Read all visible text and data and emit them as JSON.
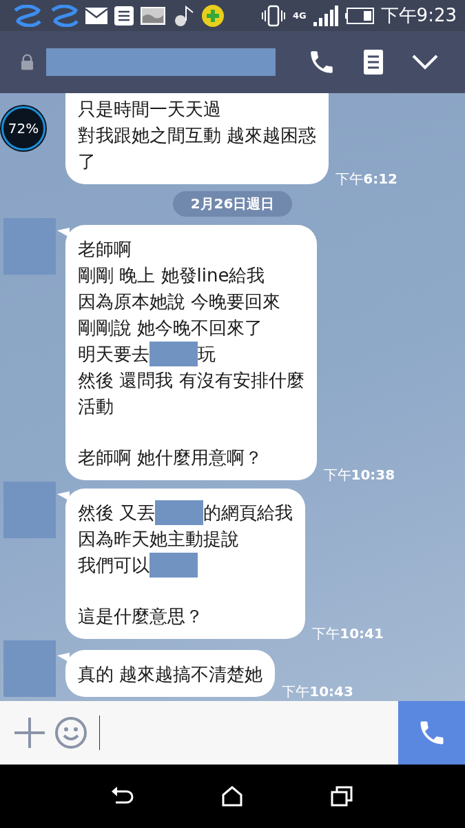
{
  "status_bar": {
    "network": "4G",
    "time": "下午9:23"
  },
  "battery_widget": {
    "text": "72%"
  },
  "chat": [
    {
      "kind": "message",
      "avatar": false,
      "cut_top": true,
      "paragraphs": [
        [
          [
            {
              "kind": "text",
              "text": "只是時間一天天過"
            }
          ],
          [
            {
              "kind": "text",
              "text": "對我跟她之間互動 越來越困惑"
            }
          ],
          [
            {
              "kind": "text",
              "text": "了"
            }
          ]
        ]
      ],
      "time": "下午**6:12**"
    },
    {
      "kind": "date",
      "text": "2月26日週日"
    },
    {
      "kind": "message",
      "avatar": true,
      "cut_top": false,
      "paragraphs": [
        [
          [
            {
              "kind": "text",
              "text": "老師啊"
            }
          ],
          [
            {
              "kind": "text",
              "text": "剛剛 晚上 她發line給我"
            }
          ],
          [
            {
              "kind": "text",
              "text": "因為原本她說 今晚要回來"
            }
          ],
          [
            {
              "kind": "text",
              "text": "剛剛說 她今晚不回來了"
            }
          ],
          [
            {
              "kind": "text",
              "text": "明天要去"
            },
            {
              "kind": "redacted"
            },
            {
              "kind": "text",
              "text": "玩"
            }
          ],
          [
            {
              "kind": "text",
              "text": "然後 還問我 有沒有安排什麼"
            }
          ],
          [
            {
              "kind": "text",
              "text": "活動"
            }
          ]
        ],
        [
          [
            {
              "kind": "text",
              "text": "老師啊 她什麼用意啊？"
            }
          ]
        ]
      ],
      "time": "下午**10:38**"
    },
    {
      "kind": "message",
      "avatar": true,
      "cut_top": false,
      "paragraphs": [
        [
          [
            {
              "kind": "text",
              "text": "然後 又丟"
            },
            {
              "kind": "redacted"
            },
            {
              "kind": "text",
              "text": "的網頁給我"
            }
          ],
          [
            {
              "kind": "text",
              "text": "因為昨天她主動提說"
            }
          ],
          [
            {
              "kind": "text",
              "text": "我們可以"
            },
            {
              "kind": "redacted"
            }
          ]
        ],
        [
          [
            {
              "kind": "text",
              "text": "這是什麼意思？"
            }
          ]
        ]
      ],
      "time": "下午**10:41**"
    },
    {
      "kind": "message",
      "avatar": true,
      "cut_top": false,
      "paragraphs": [
        [
          [
            {
              "kind": "text",
              "text": "真的 越來越搞不清楚她"
            }
          ]
        ]
      ],
      "time": "下午**10:43**"
    }
  ]
}
